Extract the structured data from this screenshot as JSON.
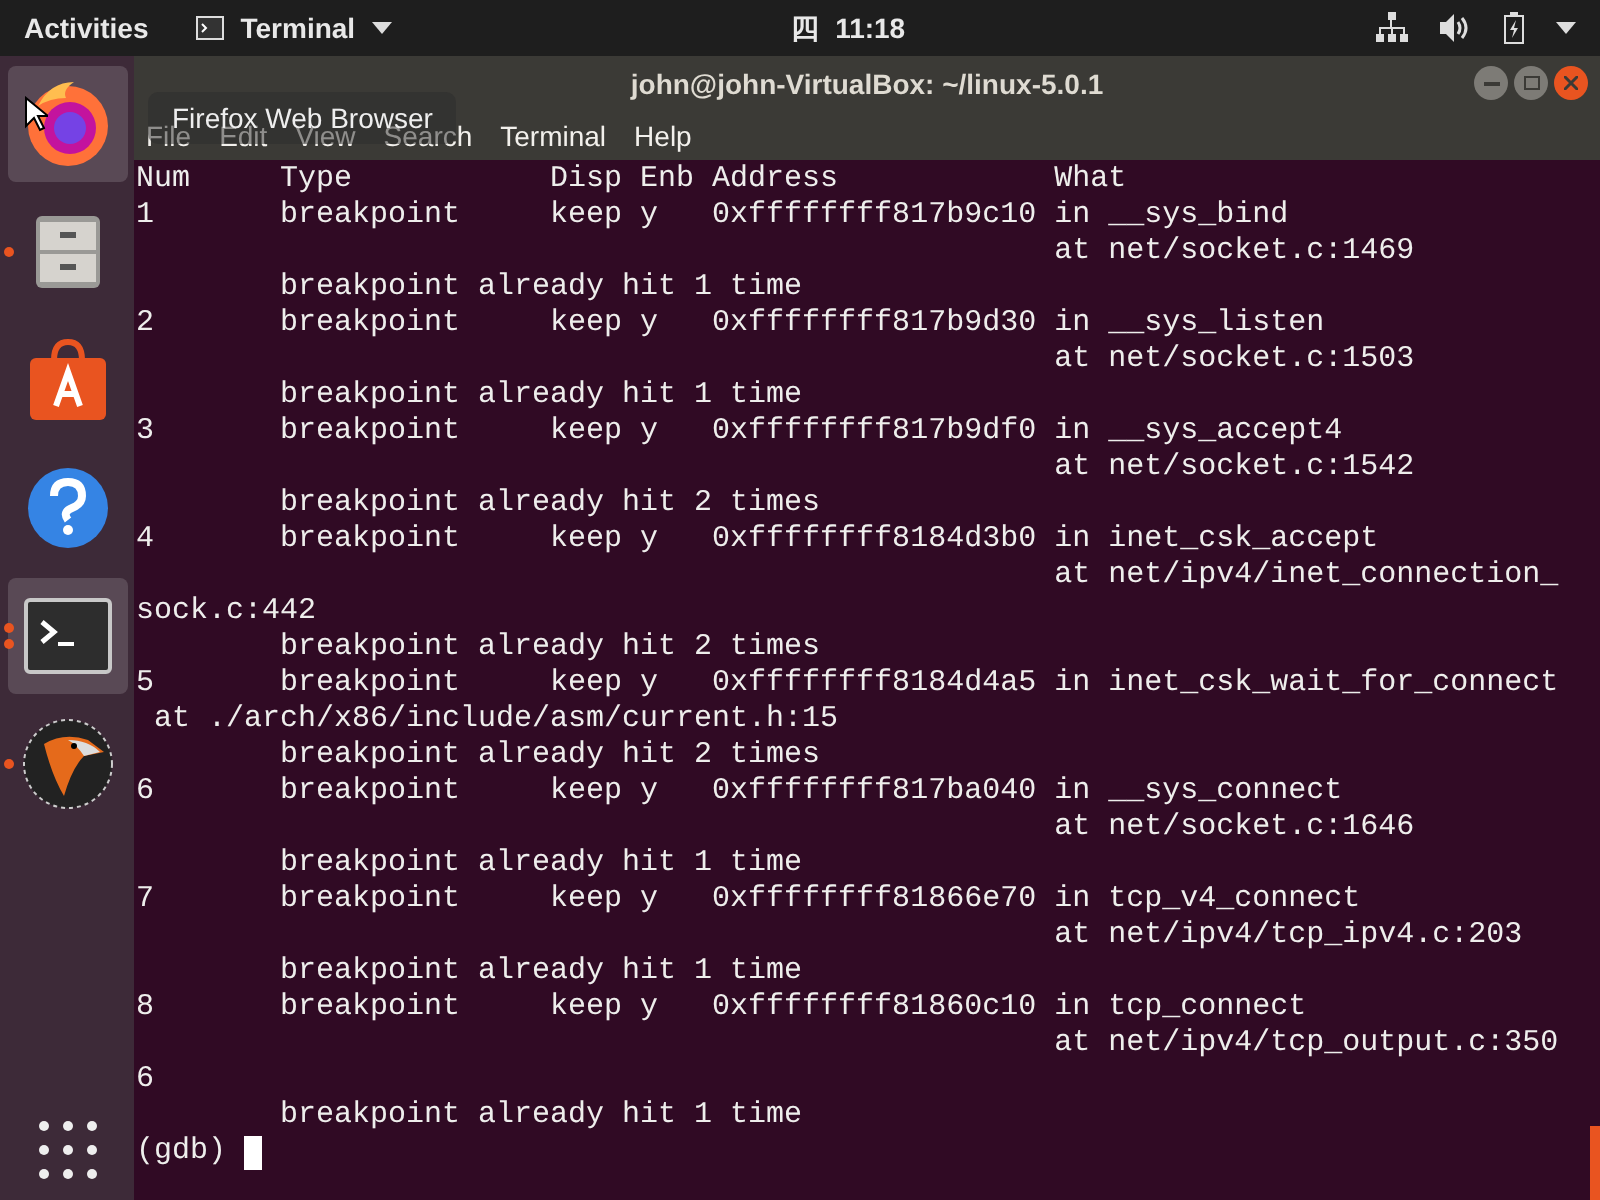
{
  "top_bar": {
    "activities": "Activities",
    "app_menu": "Terminal",
    "weekday": "四",
    "clock": "11:18"
  },
  "dock": {
    "items": [
      {
        "kind": "firefox",
        "active": true,
        "running": false
      },
      {
        "kind": "files",
        "active": false,
        "running": true
      },
      {
        "kind": "software",
        "active": false,
        "running": false
      },
      {
        "kind": "help",
        "active": false,
        "running": false
      },
      {
        "kind": "terminal",
        "active": true,
        "running": true
      },
      {
        "kind": "bird",
        "active": false,
        "running": true
      }
    ]
  },
  "tooltip": "Firefox Web Browser",
  "window": {
    "title": "john@john-VirtualBox: ~/linux-5.0.1"
  },
  "menu": [
    "File",
    "Edit",
    "View",
    "Search",
    "Terminal",
    "Help"
  ],
  "terminal": {
    "lines": [
      "Num     Type           Disp Enb Address            What",
      "1       breakpoint     keep y   0xffffffff817b9c10 in __sys_bind",
      "                                                   at net/socket.c:1469",
      "        breakpoint already hit 1 time",
      "2       breakpoint     keep y   0xffffffff817b9d30 in __sys_listen",
      "                                                   at net/socket.c:1503",
      "        breakpoint already hit 1 time",
      "3       breakpoint     keep y   0xffffffff817b9df0 in __sys_accept4",
      "                                                   at net/socket.c:1542",
      "        breakpoint already hit 2 times",
      "4       breakpoint     keep y   0xffffffff8184d3b0 in inet_csk_accept",
      "                                                   at net/ipv4/inet_connection_",
      "sock.c:442",
      "        breakpoint already hit 2 times",
      "5       breakpoint     keep y   0xffffffff8184d4a5 in inet_csk_wait_for_connect",
      " at ./arch/x86/include/asm/current.h:15",
      "        breakpoint already hit 2 times",
      "6       breakpoint     keep y   0xffffffff817ba040 in __sys_connect",
      "                                                   at net/socket.c:1646",
      "        breakpoint already hit 1 time",
      "7       breakpoint     keep y   0xffffffff81866e70 in tcp_v4_connect",
      "                                                   at net/ipv4/tcp_ipv4.c:203",
      "        breakpoint already hit 1 time",
      "8       breakpoint     keep y   0xffffffff81860c10 in tcp_connect",
      "                                                   at net/ipv4/tcp_output.c:350",
      "6",
      "        breakpoint already hit 1 time"
    ],
    "prompt": "(gdb)"
  }
}
